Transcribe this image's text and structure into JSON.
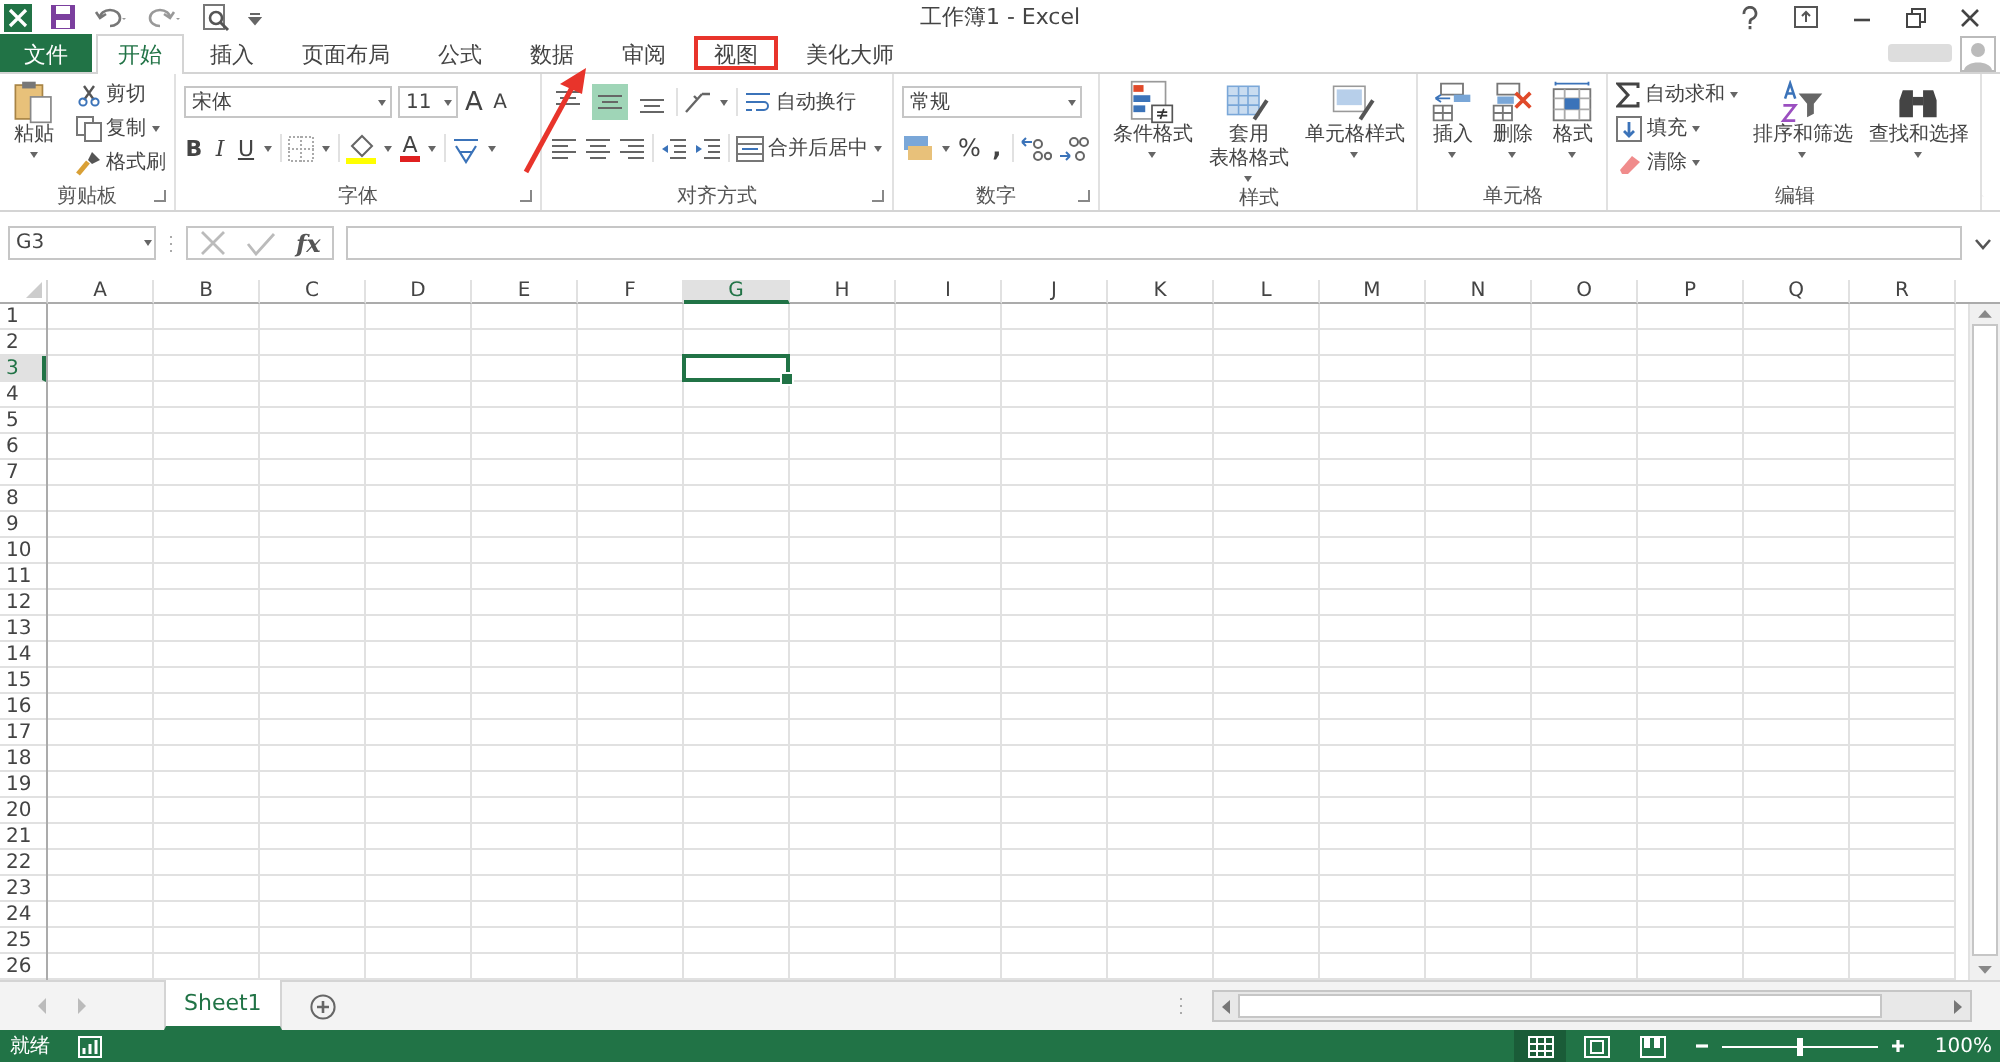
{
  "title": "工作簿1 - Excel",
  "tabs": [
    {
      "label": "文件",
      "kind": "file",
      "selected": false,
      "highlighted": false
    },
    {
      "label": "开始",
      "kind": "tab",
      "selected": true,
      "highlighted": false
    },
    {
      "label": "插入",
      "kind": "tab",
      "selected": false,
      "highlighted": false
    },
    {
      "label": "页面布局",
      "kind": "tab",
      "selected": false,
      "highlighted": false
    },
    {
      "label": "公式",
      "kind": "tab",
      "selected": false,
      "highlighted": false
    },
    {
      "label": "数据",
      "kind": "tab",
      "selected": false,
      "highlighted": false
    },
    {
      "label": "审阅",
      "kind": "tab",
      "selected": false,
      "highlighted": false
    },
    {
      "label": "视图",
      "kind": "tab",
      "selected": false,
      "highlighted": true
    },
    {
      "label": "美化大师",
      "kind": "tab",
      "selected": false,
      "highlighted": false
    }
  ],
  "clipboard": {
    "paste": "粘贴",
    "cut": "剪切",
    "copy": "复制",
    "painter": "格式刷",
    "group": "剪贴板"
  },
  "font": {
    "name": "宋体",
    "size": "11",
    "grow": "A",
    "shrink": "A",
    "bold": "B",
    "italic": "I",
    "underline": "U",
    "color_letter": "A",
    "group": "字体"
  },
  "alignment": {
    "vertical": [
      {
        "selected": false
      },
      {
        "selected": true
      },
      {
        "selected": false
      }
    ],
    "wrap": "自动换行",
    "merge": "合并后居中",
    "group": "对齐方式"
  },
  "number": {
    "format": "常规",
    "percent": "%",
    "comma": ",",
    "group": "数字"
  },
  "styles": {
    "items": [
      {
        "lines": [
          "条件格式"
        ],
        "kind": "conditional"
      },
      {
        "lines": [
          "套用",
          "表格格式"
        ],
        "kind": "table"
      },
      {
        "lines": [
          "单元格样式"
        ],
        "kind": "cellstyle"
      }
    ],
    "group": "样式"
  },
  "cells": {
    "items": [
      {
        "label": "插入",
        "kind": "insert"
      },
      {
        "label": "删除",
        "kind": "delete"
      },
      {
        "label": "格式",
        "kind": "format"
      }
    ],
    "group": "单元格"
  },
  "editing": {
    "autosum": "自动求和",
    "fill": "填充",
    "clear": "清除",
    "sort": "排序和筛选",
    "find": "查找和选择",
    "group": "编辑"
  },
  "name_box": "G3",
  "fx": "fx",
  "columns": [
    {
      "label": "A",
      "selected": false
    },
    {
      "label": "B",
      "selected": false
    },
    {
      "label": "C",
      "selected": false
    },
    {
      "label": "D",
      "selected": false
    },
    {
      "label": "E",
      "selected": false
    },
    {
      "label": "F",
      "selected": false
    },
    {
      "label": "G",
      "selected": true
    },
    {
      "label": "H",
      "selected": false
    },
    {
      "label": "I",
      "selected": false
    },
    {
      "label": "J",
      "selected": false
    },
    {
      "label": "K",
      "selected": false
    },
    {
      "label": "L",
      "selected": false
    },
    {
      "label": "M",
      "selected": false
    },
    {
      "label": "N",
      "selected": false
    },
    {
      "label": "O",
      "selected": false
    },
    {
      "label": "P",
      "selected": false
    },
    {
      "label": "Q",
      "selected": false
    },
    {
      "label": "R",
      "selected": false
    }
  ],
  "rows": [
    {
      "label": "1",
      "selected": false
    },
    {
      "label": "2",
      "selected": false
    },
    {
      "label": "3",
      "selected": true
    },
    {
      "label": "4",
      "selected": false
    },
    {
      "label": "5",
      "selected": false
    },
    {
      "label": "6",
      "selected": false
    },
    {
      "label": "7",
      "selected": false
    },
    {
      "label": "8",
      "selected": false
    },
    {
      "label": "9",
      "selected": false
    },
    {
      "label": "10",
      "selected": false
    },
    {
      "label": "11",
      "selected": false
    },
    {
      "label": "12",
      "selected": false
    },
    {
      "label": "13",
      "selected": false
    },
    {
      "label": "14",
      "selected": false
    },
    {
      "label": "15",
      "selected": false
    },
    {
      "label": "16",
      "selected": false
    },
    {
      "label": "17",
      "selected": false
    },
    {
      "label": "18",
      "selected": false
    },
    {
      "label": "19",
      "selected": false
    },
    {
      "label": "20",
      "selected": false
    },
    {
      "label": "21",
      "selected": false
    },
    {
      "label": "22",
      "selected": false
    },
    {
      "label": "23",
      "selected": false
    },
    {
      "label": "24",
      "selected": false
    },
    {
      "label": "25",
      "selected": false
    },
    {
      "label": "26",
      "selected": false
    }
  ],
  "sheets": [
    {
      "label": "Sheet1",
      "selected": true
    }
  ],
  "status": "就绪",
  "zoom": {
    "level": 0.5,
    "reading": "100%"
  }
}
